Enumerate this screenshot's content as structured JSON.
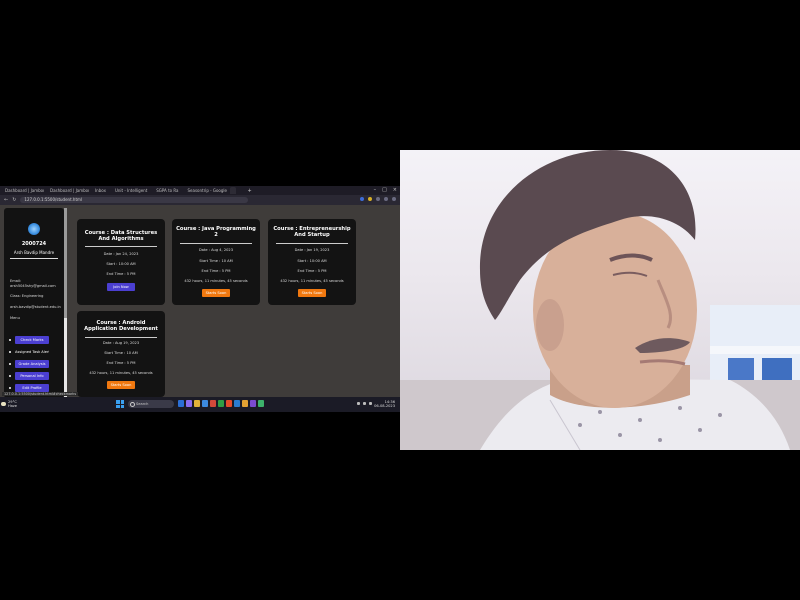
{
  "browser": {
    "tabs": [
      "Dashboard | Jamboree",
      "Dashboard | Jamboree",
      "Inbox",
      "Unit - Intelligent",
      "SGPA to Ra",
      "Seasontrip - Google Search",
      "",
      ""
    ],
    "url": "127.0.0.1:5500/student.html"
  },
  "sidebar": {
    "year": "2000724",
    "name": "Arsh Bavdip Mandre",
    "email_label": "Email: arsh5045shy@gmail.com",
    "class_label": "Class: Engineering",
    "info_line": "arsh.bavdip@student.edu.in",
    "menu_label": "Menu",
    "menu": [
      "Check Marks",
      "Assigned Task Alert",
      "Grade Analysis",
      "Personal Info",
      "Edit Profile"
    ]
  },
  "courses": [
    {
      "title": "Course : Data Structures And Algorithms",
      "date": "Date : Jan 24, 2023",
      "start": "Start : 10:00 AM",
      "end": "End Time : 5 PM",
      "duration": "",
      "button": "Join Now",
      "button_style": "blue"
    },
    {
      "title": "Course : Java Programming 2",
      "date": "Date : Aug 4, 2023",
      "start": "Start Time : 10 AM",
      "end": "End Time : 5 PM",
      "duration": "432 hours, 11 minutes, 45 seconds",
      "button": "Starts Soon",
      "button_style": "orange"
    },
    {
      "title": "Course : Entrepreneurship And Startup",
      "date": "Date : Jan 19, 2023",
      "start": "Start : 10:00 AM",
      "end": "End Time : 5 PM",
      "duration": "432 hours, 11 minutes, 45 seconds",
      "button": "Starts Soon",
      "button_style": "orange"
    },
    {
      "title": "Course : Android Application Development",
      "date": "Date : Aug 19, 2023",
      "start": "Start Time : 10 AM",
      "end": "End Time : 5 PM",
      "duration": "432 hours, 11 minutes, 45 seconds",
      "button": "Starts Soon",
      "button_style": "orange"
    }
  ],
  "taskbar": {
    "status_url": "127.0.0.1:5500/student.html#checkmarks",
    "weather_temp": "29°C",
    "weather_desc": "Haze",
    "search_label": "Search",
    "time": "14:36",
    "date": "06-08-2023"
  },
  "colors": {
    "accent_blue": "#4b3fd1",
    "accent_orange": "#f0780f",
    "card_bg": "#131313",
    "page_bg": "#3f3c3a"
  }
}
